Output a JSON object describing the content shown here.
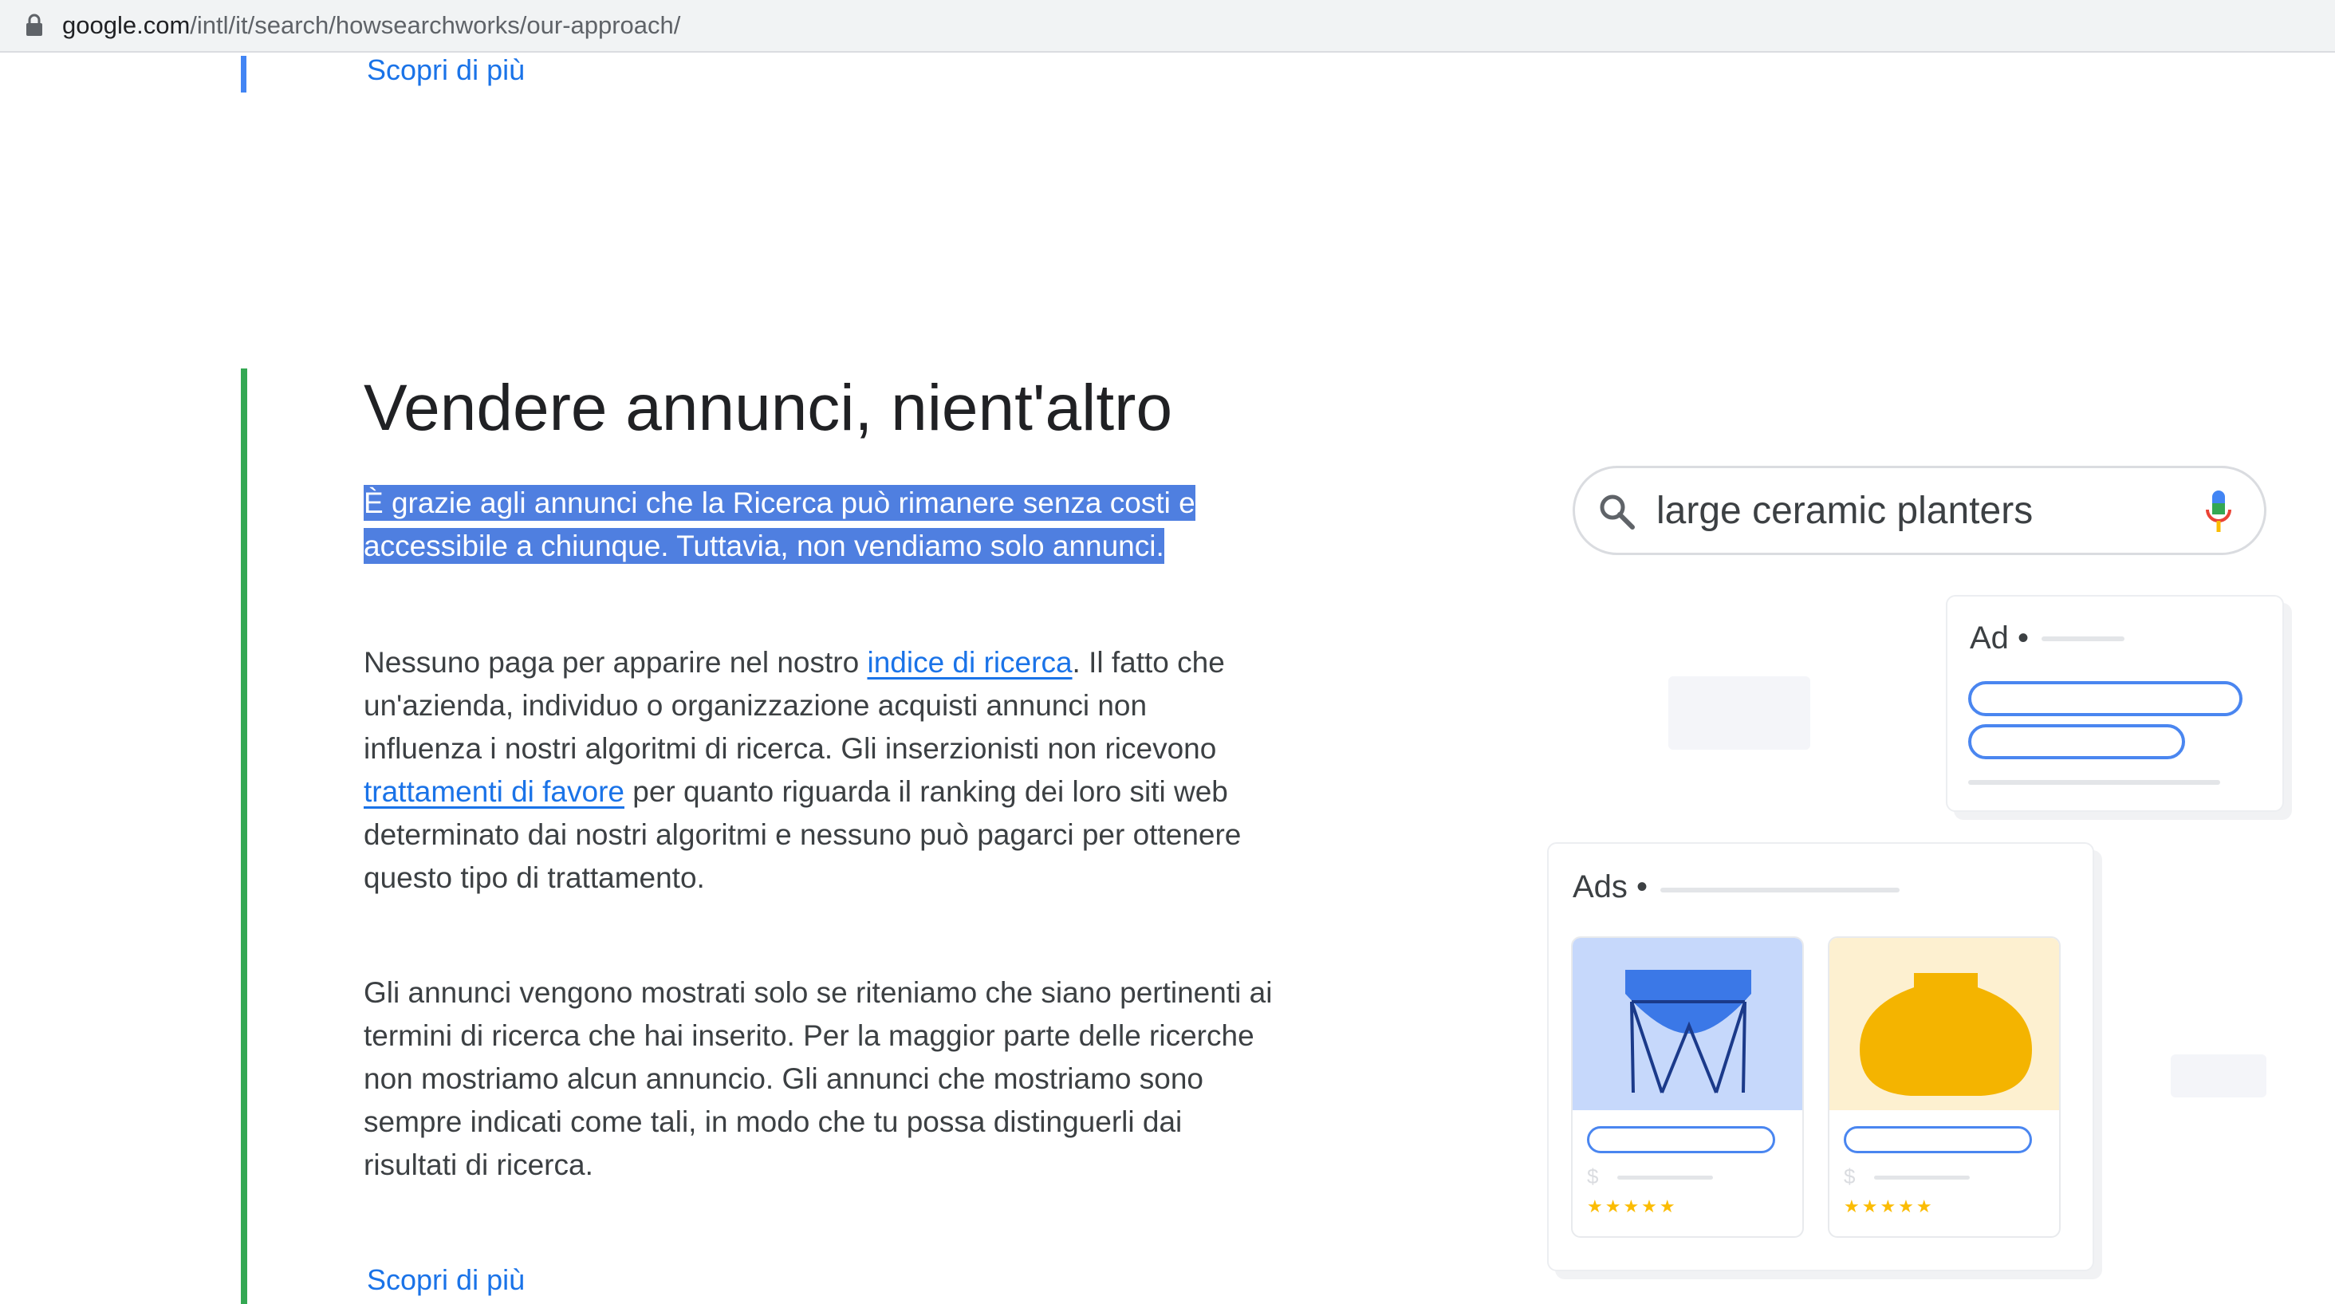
{
  "browser": {
    "url_host": "google.com",
    "url_path": "/intl/it/search/howsearchworks/our-approach/"
  },
  "top_link": "Scopri di più",
  "section": {
    "title": "Vendere annunci, nient'altro",
    "lead": "È grazie agli annunci che la Ricerca può rimanere senza costi e accessibile a chiunque. Tuttavia, non vendiamo solo annunci.",
    "p1": {
      "t1": "Nessuno paga per apparire nel nostro ",
      "link1": "indice di ricerca",
      "t2": ". Il fatto che un'azienda, individuo o organizzazione acquisti annunci non influenza i nostri algoritmi di ricerca. Gli inserzionisti non ricevono ",
      "link2": "trattamenti di favore",
      "t3": " per quanto riguarda il ranking dei loro siti web determinato dai nostri algoritmi e nessuno può pagarci per ottenere questo tipo di trattamento."
    },
    "p2": "Gli annunci vengono mostrati solo se riteniamo che siano pertinenti ai termini di ricerca che hai inserito. Per la maggior parte delle ricerche non mostriamo alcun annuncio. Gli annunci che mostriamo sono sempre indicati come tali, in modo che tu possa distinguerli dai risultati di ricerca.",
    "bottom_link": "Scopri di più"
  },
  "illustration": {
    "query": "large ceramic planters",
    "ad_label": "Ad •",
    "ads_label": "Ads •",
    "price_symbol": "$",
    "stars": "★★★★★",
    "icons": [
      "lock-icon",
      "search-icon",
      "mic-icon",
      "planter-stand-icon",
      "vase-icon"
    ],
    "colors": {
      "accent_blue": "#4285f4",
      "accent_green": "#34a853",
      "highlight": "#4f7fe0",
      "product_blue_bg": "#c6d8fb",
      "product_yellow_bg": "#fdf0d0",
      "vase_yellow": "#f4b400"
    }
  }
}
